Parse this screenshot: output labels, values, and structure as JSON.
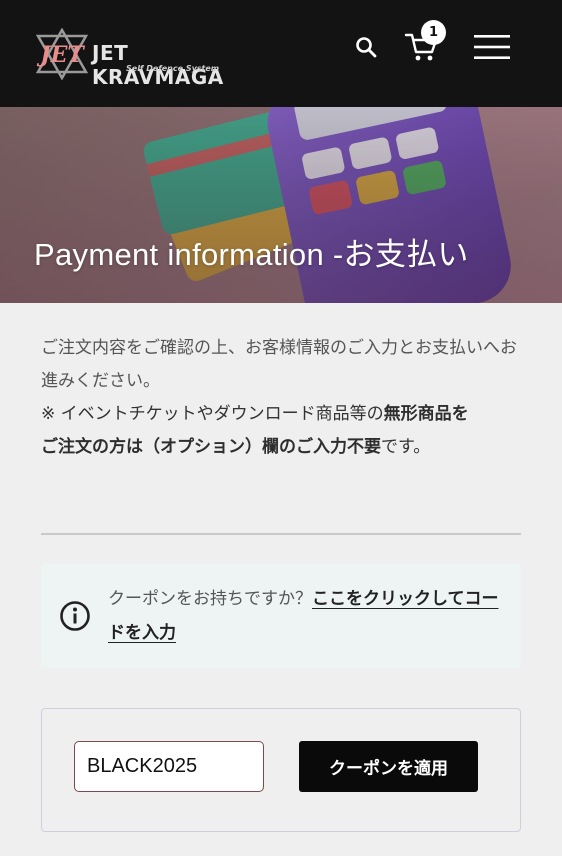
{
  "header": {
    "brand": "JET KRAVMAGA",
    "tagline": "Self Defence System",
    "logo_mark": "JET",
    "cart_count": "1",
    "icons": {
      "search": "search-icon",
      "cart": "cart-icon",
      "menu": "menu-icon"
    },
    "background": "#131313"
  },
  "hero": {
    "title": "Payment information -お支払い"
  },
  "intro": {
    "line1": "ご注文内容をご確認の上、お客様情報のご入力とお支払いへお進みください。",
    "note_prefix": "※ イベントチケットやダウンロード商品等の",
    "note_bold1": "無形商品を",
    "note_bold2": "ご注文の方は（オプション）欄のご入力不要",
    "note_suffix": "です。"
  },
  "coupon_notice": {
    "text": "クーポンをお持ちですか？",
    "link": "ここをクリックしてコードを入力",
    "icon": "info-icon"
  },
  "coupon_form": {
    "code_value": "BLACK2025",
    "apply_label": "クーポンを適用"
  }
}
